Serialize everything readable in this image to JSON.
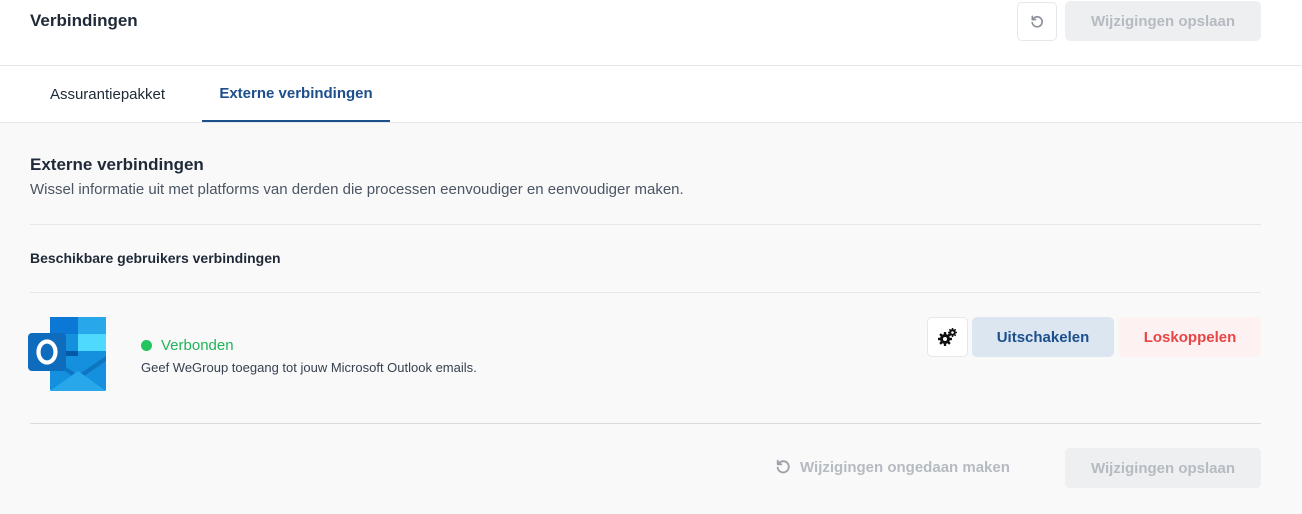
{
  "header": {
    "title": "Verbindingen",
    "save_label": "Wijzigingen opslaan",
    "undo_icon": "undo-icon"
  },
  "tabs": [
    {
      "label": "Assurantiepakket",
      "active": false
    },
    {
      "label": "Externe verbindingen",
      "active": true
    }
  ],
  "section": {
    "title": "Externe verbindingen",
    "description": "Wissel informatie uit met platforms van derden die processen eenvoudiger en eenvoudiger maken.",
    "subtitle": "Beschikbare gebruikers verbindingen"
  },
  "connection": {
    "icon": "outlook-icon",
    "status": "Verbonden",
    "status_color": "#22c55e",
    "description": "Geef WeGroup toegang tot jouw Microsoft Outlook emails.",
    "settings_icon": "gears-icon",
    "disable_label": "Uitschakelen",
    "disconnect_label": "Loskoppelen"
  },
  "footer": {
    "revert_label": "Wijzigingen ongedaan maken",
    "save_label": "Wijzigingen opslaan"
  },
  "colors": {
    "accent": "#1d4f8c",
    "danger": "#e84545",
    "success": "#22c55e"
  }
}
